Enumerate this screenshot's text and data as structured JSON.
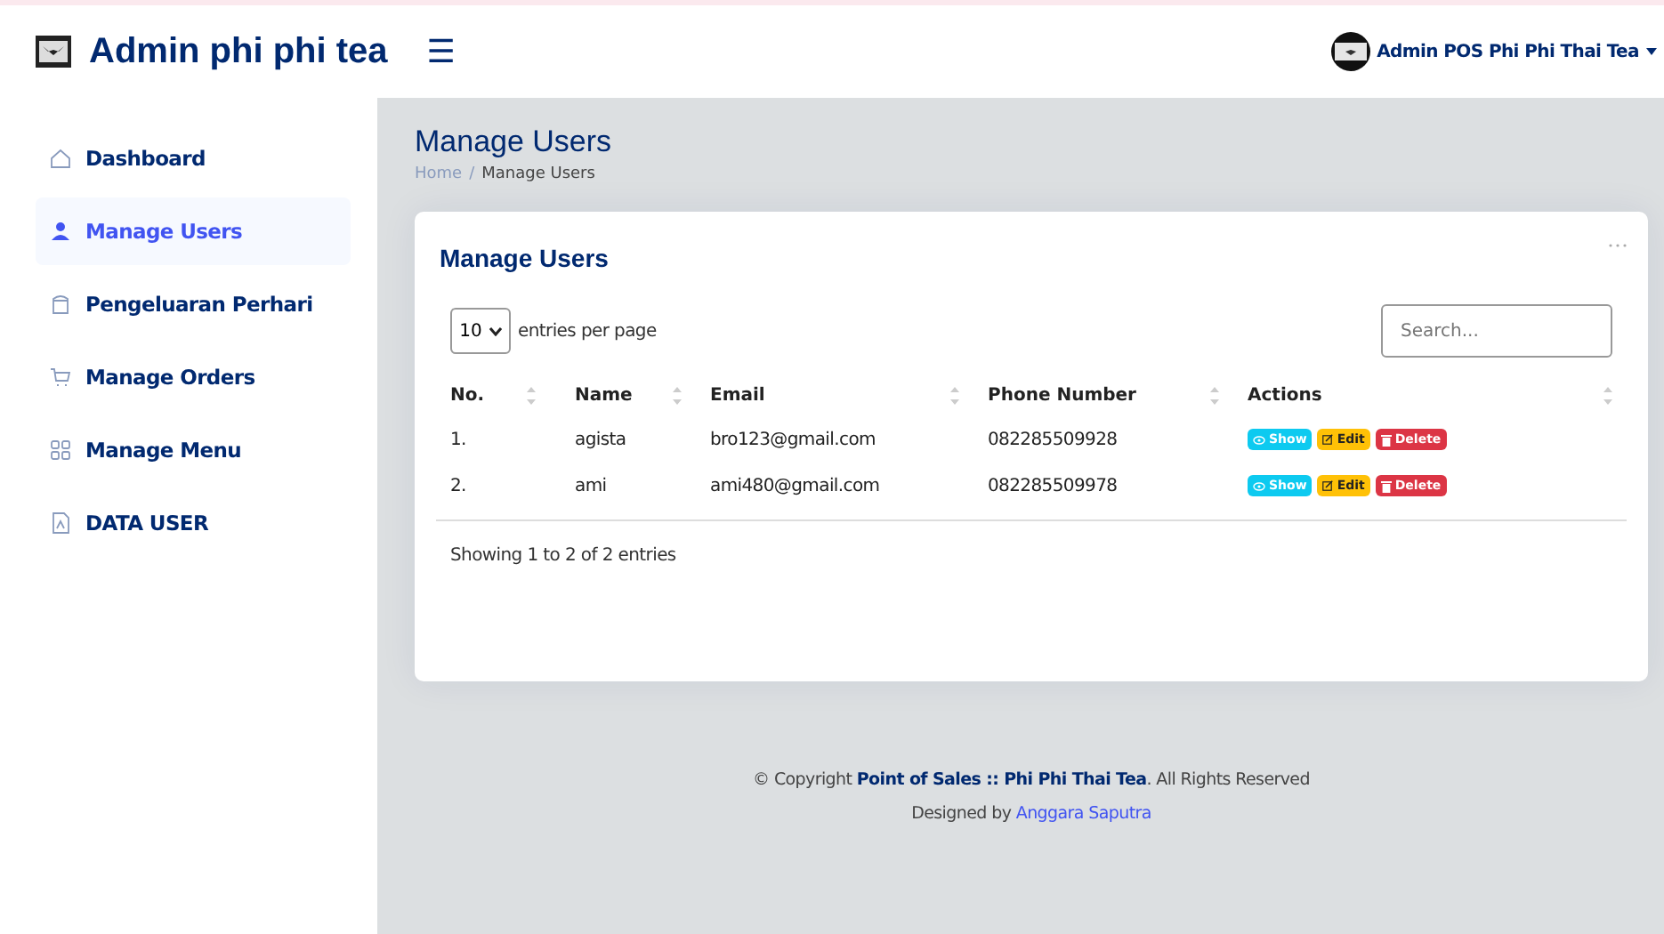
{
  "header": {
    "brand": "Admin phi phi tea",
    "menu_glyph": "☰",
    "user": "Admin POS Phi Phi Thai Tea"
  },
  "sidebar": {
    "items": [
      {
        "label": "Dashboard",
        "kind": "home",
        "selected": false
      },
      {
        "label": "Manage Users",
        "kind": "person",
        "selected": true
      },
      {
        "label": "Pengeluaran Perhari",
        "kind": "cup",
        "selected": false
      },
      {
        "label": "Manage Orders",
        "kind": "cart",
        "selected": false
      },
      {
        "label": "Manage Menu",
        "kind": "grid",
        "selected": false
      },
      {
        "label": "DATA USER",
        "kind": "file",
        "selected": false
      }
    ]
  },
  "page": {
    "title": "Manage Users",
    "breadcrumb": [
      {
        "label": "Home"
      },
      {
        "label": "Manage Users"
      }
    ],
    "breadcrumb_separator": "/"
  },
  "card": {
    "title": "Manage Users",
    "per_page": "10",
    "per_page_label": "entries per page",
    "search": {
      "placeholder": "Search..."
    },
    "table": {
      "columns": [
        "No.",
        "Name",
        "Email",
        "Phone Number",
        "Actions"
      ],
      "rows": [
        {
          "no": "1.",
          "name": "agista",
          "email": "bro123@gmail.com",
          "phone": "082285509928",
          "actions": [
            {
              "kind": "show",
              "label": "Show"
            },
            {
              "kind": "edit",
              "label": "Edit"
            },
            {
              "kind": "delete",
              "label": "Delete"
            }
          ]
        },
        {
          "no": "2.",
          "name": "ami",
          "email": "ami480@gmail.com",
          "phone": "082285509978",
          "actions": [
            {
              "kind": "show",
              "label": "Show"
            },
            {
              "kind": "edit",
              "label": "Edit"
            },
            {
              "kind": "delete",
              "label": "Delete"
            }
          ]
        }
      ]
    },
    "info": "Showing 1 to 2 of 2 entries"
  },
  "footer": {
    "copyright": "© Copyright **Point of Sales :: Phi Phi Thai Tea**. All Rights Reserved",
    "designed_by": "Designed by",
    "author": "Anggara Saputra"
  }
}
